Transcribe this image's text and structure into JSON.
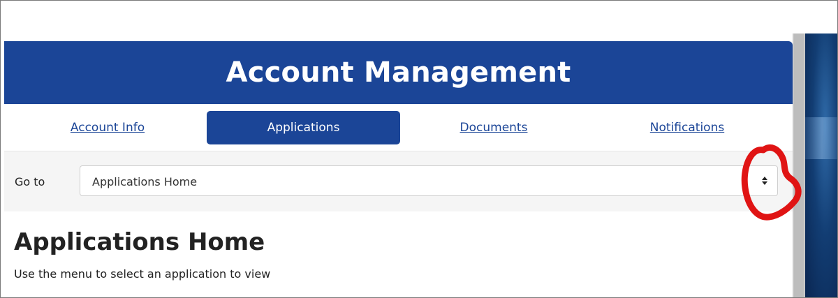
{
  "header": {
    "title": "Account Management"
  },
  "tabs": [
    {
      "label": "Account Info",
      "active": false
    },
    {
      "label": "Applications",
      "active": true
    },
    {
      "label": "Documents",
      "active": false
    },
    {
      "label": "Notifications",
      "active": false
    }
  ],
  "goto": {
    "label": "Go to",
    "selected": "Applications Home",
    "arrow_icon": "up-down-arrows-icon"
  },
  "main": {
    "heading": "Applications Home",
    "description": "Use the menu to select an application to view"
  },
  "annotation": {
    "shape": "hand-drawn-circle",
    "color": "#e01414"
  },
  "colors": {
    "brand": "#1b4597",
    "bar_bg": "#f5f5f5"
  }
}
